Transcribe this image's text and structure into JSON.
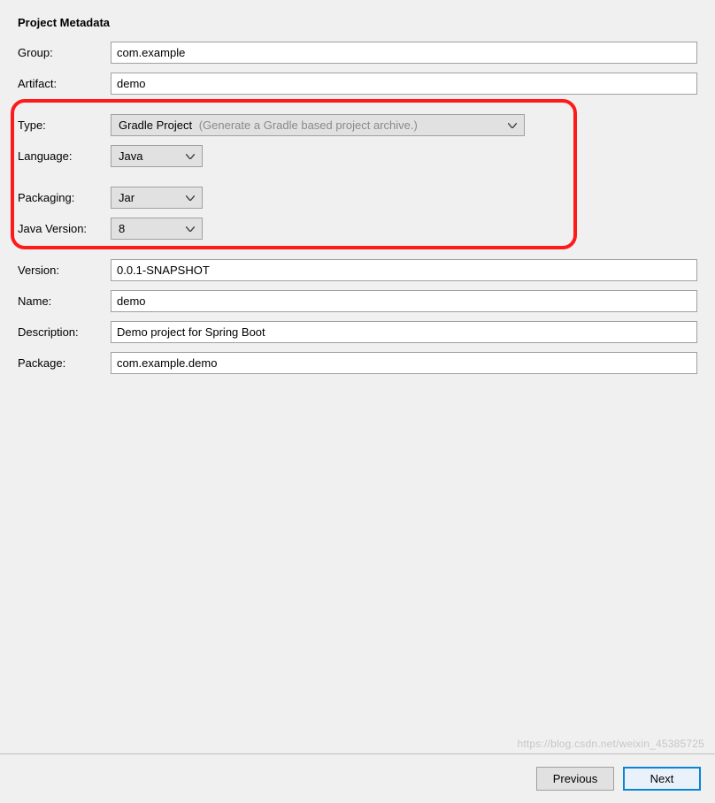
{
  "section_title": "Project Metadata",
  "fields": {
    "group": {
      "label": "Group:",
      "value": "com.example"
    },
    "artifact": {
      "label": "Artifact:",
      "value": "demo"
    },
    "type": {
      "label": "Type:",
      "value": "Gradle Project",
      "hint": "(Generate a Gradle based project archive.)"
    },
    "language": {
      "label": "Language:",
      "value": "Java"
    },
    "packaging": {
      "label": "Packaging:",
      "value": "Jar"
    },
    "java_version": {
      "label": "Java Version:",
      "value": "8"
    },
    "version": {
      "label": "Version:",
      "value": "0.0.1-SNAPSHOT"
    },
    "name": {
      "label": "Name:",
      "value": "demo"
    },
    "description": {
      "label": "Description:",
      "value": "Demo project for Spring Boot"
    },
    "package": {
      "label": "Package:",
      "value": "com.example.demo"
    }
  },
  "buttons": {
    "previous": "Previous",
    "next": "Next"
  },
  "watermark": "https://blog.csdn.net/weixin_45385725"
}
